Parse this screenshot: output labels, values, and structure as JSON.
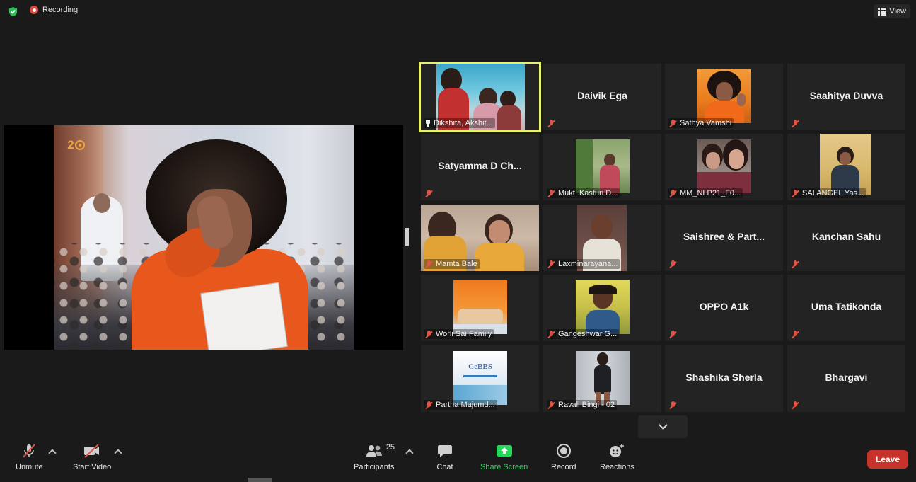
{
  "topbar": {
    "recording_label": "Recording",
    "view_label": "View",
    "security_icon": "shield-check-icon"
  },
  "share_screen": {
    "badge_text": "2",
    "description_icon": "shared-video"
  },
  "gallery": {
    "tiles": [
      {
        "name": "Dikshita, Akshit...",
        "video": true,
        "pinned": true,
        "active": true
      },
      {
        "name": "Daivik Ega",
        "video": false
      },
      {
        "name": "Sathya Vamshi",
        "video": true
      },
      {
        "name": "Saahitya Duvva",
        "video": false
      },
      {
        "name": "Satyamma D Ch...",
        "video": false
      },
      {
        "name": "Mukt..Kasturi D...",
        "video": true
      },
      {
        "name": "MM_NLP21_F0...",
        "video": true
      },
      {
        "name": "SAI ANGEL Yas...",
        "video": true
      },
      {
        "name": "Mamta Bale",
        "video": true
      },
      {
        "name": "Laxminarayana...",
        "video": true
      },
      {
        "name": "Saishree & Part...",
        "video": false
      },
      {
        "name": "Kanchan Sahu",
        "video": false
      },
      {
        "name": "Worli Sai Family",
        "video": true
      },
      {
        "name": "Gangeshwar G...",
        "video": true
      },
      {
        "name": "OPPO A1k",
        "video": false
      },
      {
        "name": "Uma Tatikonda",
        "video": false
      },
      {
        "name": "Partha Majumd...",
        "video": true
      },
      {
        "name": "Ravali Bingi - 02",
        "video": true
      },
      {
        "name": "Shashika Sherla",
        "video": false
      },
      {
        "name": "Bhargavi",
        "video": false
      }
    ],
    "gebbs_text": "GeBBS"
  },
  "toolbar": {
    "unmute_label": "Unmute",
    "start_video_label": "Start Video",
    "participants_label": "Participants",
    "participants_count": "25",
    "chat_label": "Chat",
    "share_screen_label": "Share Screen",
    "record_label": "Record",
    "reactions_label": "Reactions",
    "leave_label": "Leave"
  },
  "colors": {
    "background": "#1a1a1a",
    "tile_bg": "#232323",
    "active_border": "#e8f36b",
    "share_green": "#23d959",
    "leave_red": "#c5332a",
    "mute_red": "#e25445"
  }
}
